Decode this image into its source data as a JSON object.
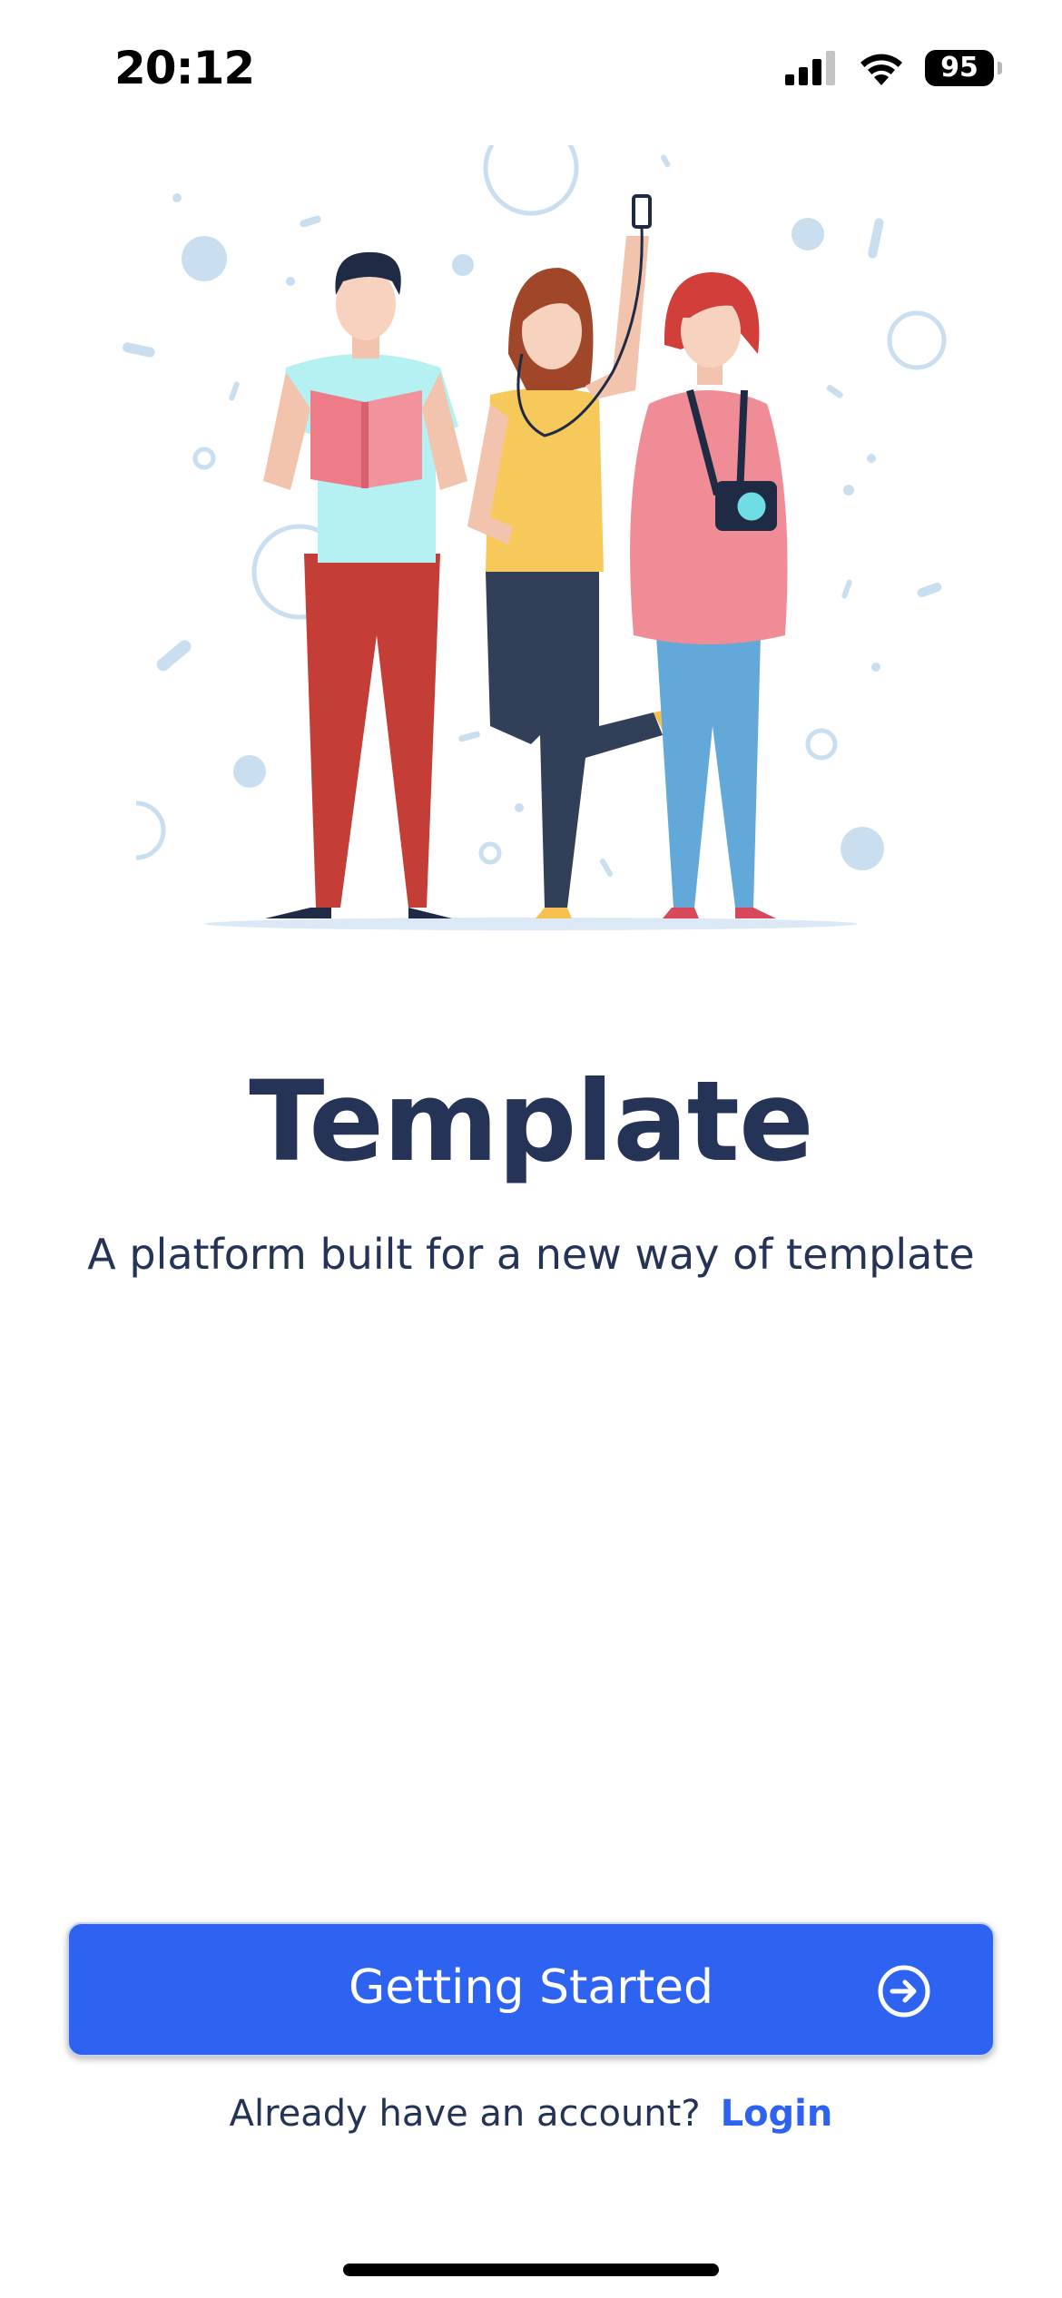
{
  "status_bar": {
    "time": "20:12",
    "battery": "95",
    "icons": [
      "signal-icon",
      "wifi-icon",
      "battery-icon"
    ]
  },
  "hero": {
    "illustration": "three-people-illustration"
  },
  "app": {
    "title": "Template",
    "subtitle": "A platform built for a new way of template"
  },
  "cta": {
    "label": "Getting Started",
    "icon": "arrow-right-circle-icon"
  },
  "login": {
    "prompt": "Already have an account?",
    "link": "Login"
  },
  "colors": {
    "primary": "#2d63f0",
    "text_dark": "#253356",
    "background": "#ffffff"
  }
}
